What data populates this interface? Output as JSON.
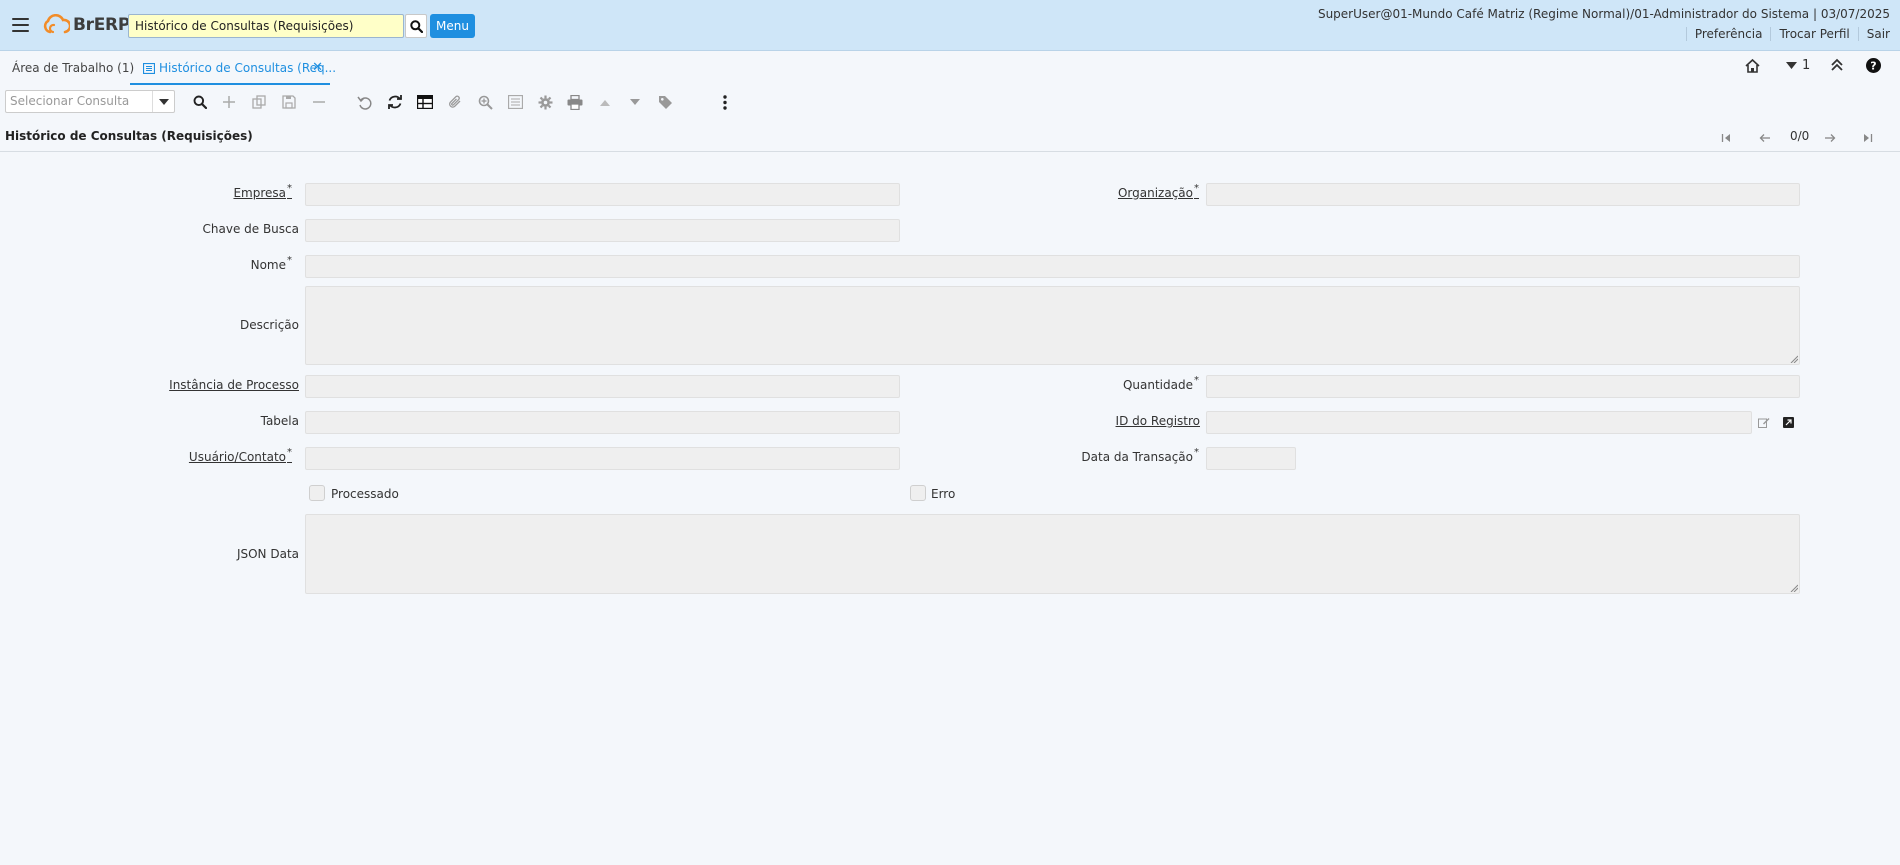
{
  "header": {
    "logo_text": "BrERP",
    "search_value": "Histórico de Consultas (Requisições)",
    "menu_label": "Menu",
    "user_info": "SuperUser@01-Mundo Café Matriz (Regime Normal)/01-Administrador do Sistema | 03/07/2025",
    "links": [
      "Preferência",
      "Trocar Perfil",
      "Sair"
    ]
  },
  "tabs": {
    "work_area": "Área de Trabalho (1)",
    "active": "Histórico de Consultas (Req..."
  },
  "tab_right": {
    "count": "1"
  },
  "toolbar": {
    "select_query_placeholder": "Selecionar Consulta"
  },
  "window": {
    "title": "Histórico de Consultas (Requisições)",
    "record_count": "0/0"
  },
  "form": {
    "empresa": "Empresa",
    "organizacao": "Organização",
    "chave_busca": "Chave de Busca",
    "nome": "Nome",
    "descricao": "Descrição",
    "instancia_processo": "Instância de Processo",
    "quantidade": "Quantidade",
    "tabela": "Tabela",
    "id_registro": "ID do Registro",
    "usuario_contato": "Usuário/Contato",
    "data_transacao": "Data da Transação",
    "processado": "Processado",
    "erro": "Erro",
    "json_data": "JSON Data",
    "required_mark": "*"
  },
  "colors": {
    "header_bg": "#cfe6f8",
    "accent": "#1f8fe0",
    "search_bg": "#ffffc8",
    "field_bg": "#efefef"
  }
}
